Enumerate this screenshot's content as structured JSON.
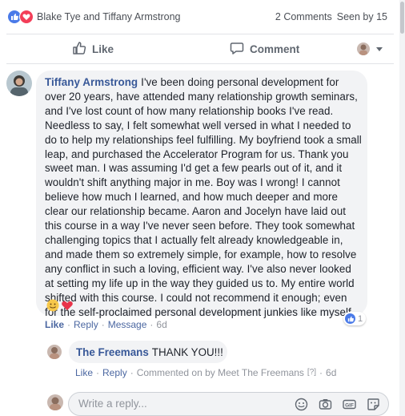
{
  "reactions": {
    "names": "Blake Tye and Tiffany Armstrong",
    "comments_count": "2 Comments",
    "seen_by": "Seen by 15"
  },
  "actions": {
    "like_label": "Like",
    "comment_label": "Comment"
  },
  "comment": {
    "author": "Tiffany Armstrong",
    "text": "I've been doing personal development for over 20 years, have attended many relationship growth seminars, and I've lost count of how many relationship books I've read. Needless to say, I felt somewhat well versed in what I needed to do to help my relationships feel fulfilling. My boyfriend took a small leap, and purchased the Accelerator Program for us. Thank you sweet man. I was assuming I'd get a few pearls out of it, and it wouldn't shift anything major in me. Boy was I wrong! I cannot believe how much I learned, and how much deeper and more clear our relationship became. Aaron and Jocelyn have laid out this course in a way I've never seen before. They took somewhat challenging topics that I actually felt already knowledgeable in, and made them so extremely simple, for example, how to resolve any conflict in such a loving, efficient way. I've also never looked at setting my life up in the way they guided us to. My entire world shifted with this course. I could not recommend it enough; even for the self-proclaimed personal development junkies like myself.",
    "reaction_count": "1",
    "like": "Like",
    "reply": "Reply",
    "message": "Message",
    "time": "6d"
  },
  "reply": {
    "author": "The Freemans",
    "text": "THANK YOU!!!",
    "like": "Like",
    "reply": "Reply",
    "commented_on_by": "Commented on by Meet The Freemans",
    "badge": "[?]",
    "time": "6d"
  },
  "composer": {
    "placeholder": "Write a reply..."
  },
  "colors": {
    "link_blue": "#385898",
    "meta_blue": "#4b67a1",
    "like_blue": "#4a7ae8",
    "love_red": "#f33e58",
    "bubble_bg": "#f2f3f5"
  }
}
